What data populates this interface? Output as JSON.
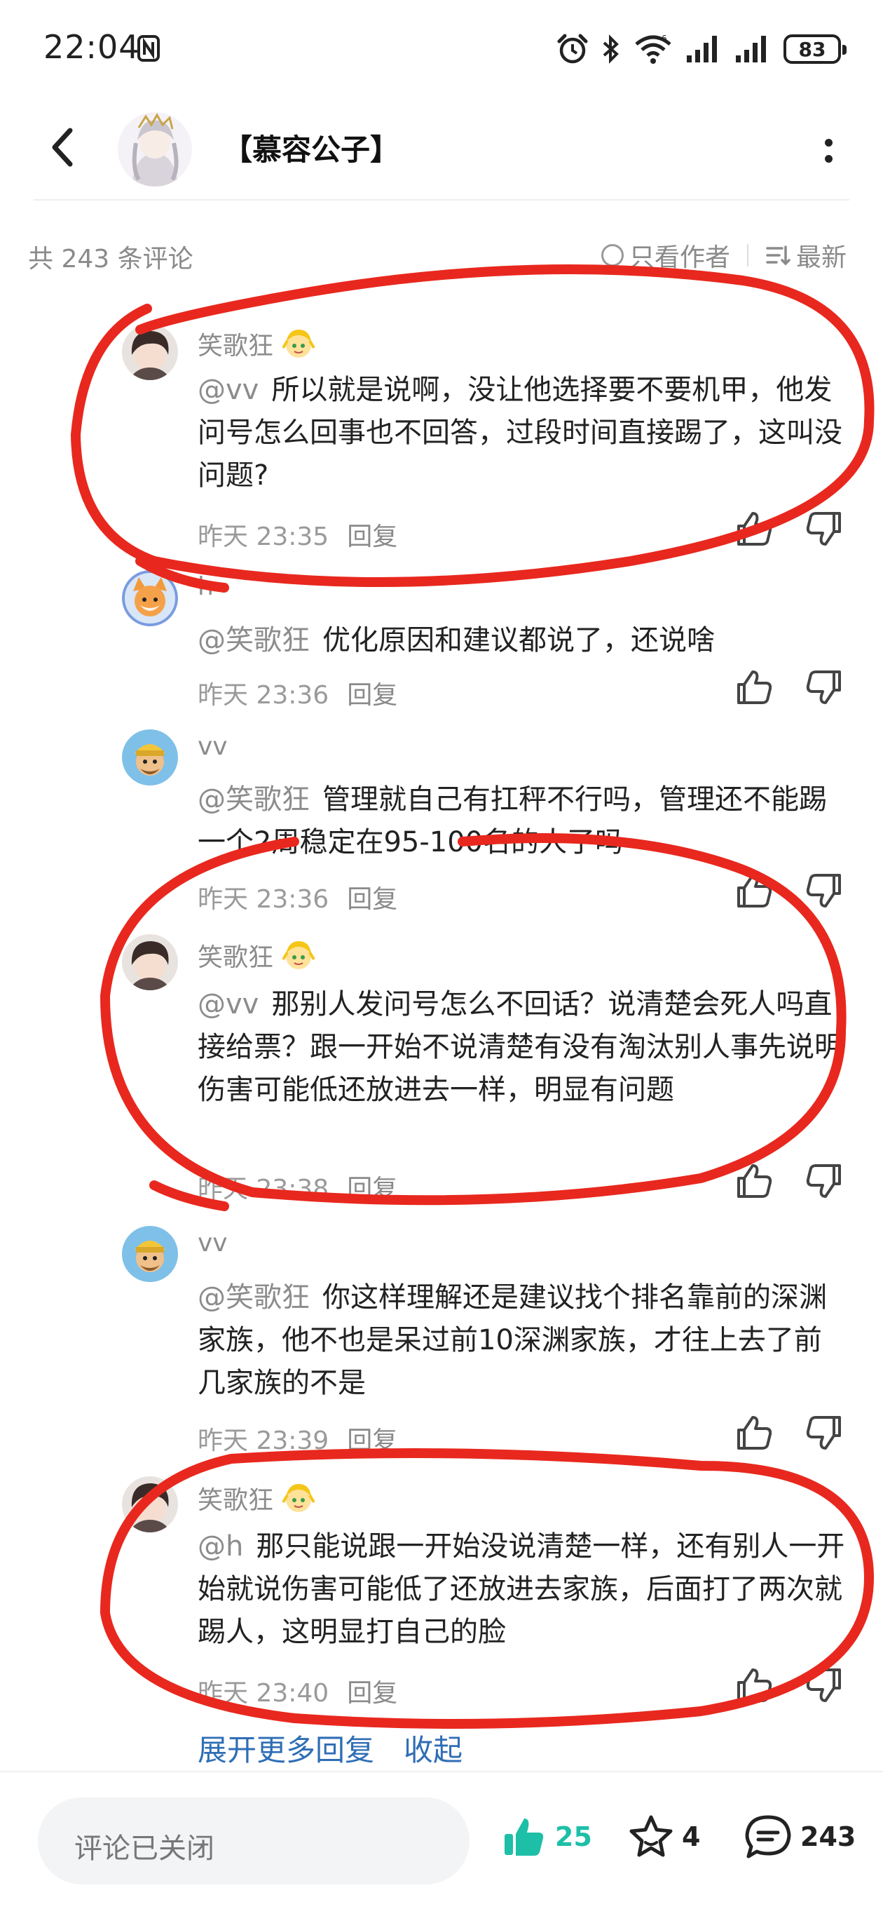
{
  "status_bar": {
    "time": "22:04",
    "battery": "83",
    "icons": [
      "nfc-icon",
      "alarm-icon",
      "bluetooth-icon",
      "wifi-icon",
      "signal-icon",
      "signal-icon",
      "battery-icon"
    ]
  },
  "header": {
    "title": "【慕容公子】",
    "back_icon": "chevron-left-icon",
    "more_icon": "more-vertical-icon"
  },
  "comments_bar": {
    "count_text": "共 243 条评论",
    "only_author": "只看作者",
    "sort": "最新"
  },
  "replies": [
    {
      "user": "笑歌狂",
      "has_badge": true,
      "mention": "@vv",
      "text": "所以就是说啊，没让他选择要不要机甲，他发问号怎么回事也不回答，过段时间直接踢了，这叫没问题?",
      "time": "昨天 23:35",
      "reply_label": "回复"
    },
    {
      "user": "h",
      "has_badge": false,
      "mention": "@笑歌狂",
      "text": "优化原因和建议都说了，还说啥",
      "time": "昨天 23:36",
      "reply_label": "回复"
    },
    {
      "user": "vv",
      "has_badge": false,
      "mention": "@笑歌狂",
      "text": "管理就自己有扛秤不行吗，管理还不能踢一个2周稳定在95-100名的人了吗",
      "time": "昨天 23:36",
      "reply_label": "回复"
    },
    {
      "user": "笑歌狂",
      "has_badge": true,
      "mention": "@vv",
      "text": "那别人发问号怎么不回话？说清楚会死人吗直接给票？跟一开始不说清楚有没有淘汰别人事先说明伤害可能低还放进去一样，明显有问题",
      "time": "昨天 23:38",
      "reply_label": "回复"
    },
    {
      "user": "vv",
      "has_badge": false,
      "mention": "@笑歌狂",
      "text": "你这样理解还是建议找个排名靠前的深渊家族，他不也是呆过前10深渊家族，才往上去了前几家族的不是",
      "time": "昨天 23:39",
      "reply_label": "回复"
    },
    {
      "user": "笑歌狂",
      "has_badge": true,
      "mention": "@h",
      "text": "那只能说跟一开始没说清楚一样，还有别人一开始就说伤害可能低了还放进去家族，后面打了两次就踢人，这明显打自己的脸",
      "time": "昨天 23:40",
      "reply_label": "回复"
    }
  ],
  "expand": {
    "more_replies": "展开更多回复",
    "collapse": "收起"
  },
  "bottom_bar": {
    "input_placeholder": "评论已关闭",
    "likes": "25",
    "favorites": "4",
    "comments": "243",
    "like_color": "#1dbfa7"
  },
  "annotation_color": "#e8281e"
}
